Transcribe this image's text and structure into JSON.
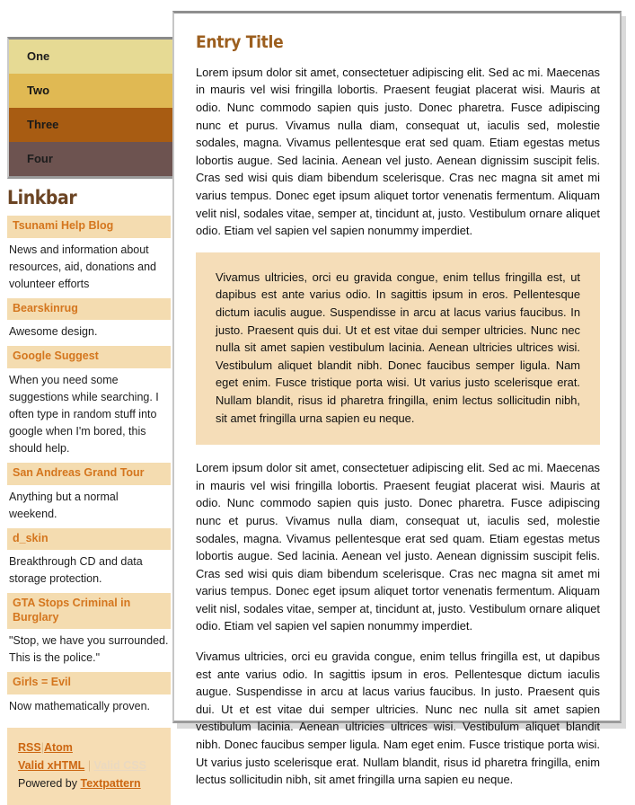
{
  "nav": {
    "items": [
      {
        "label": "One",
        "color": "#e6da94"
      },
      {
        "label": "Two",
        "color": "#e0b953"
      },
      {
        "label": "Three",
        "color": "#a85c12"
      },
      {
        "label": "Four",
        "color": "#6d5350"
      }
    ]
  },
  "linkbar": {
    "title": "Linkbar",
    "links": [
      {
        "title": "Tsunami Help Blog",
        "desc": "News and information about resources, aid, donations and volunteer efforts"
      },
      {
        "title": "Bearskinrug",
        "desc": "Awesome design."
      },
      {
        "title": "Google Suggest",
        "desc": "When you need some suggestions while searching. I often type in random stuff into google when I'm bored, this should help."
      },
      {
        "title": "San Andreas Grand Tour",
        "desc": "Anything but a normal weekend."
      },
      {
        "title": "d_skin",
        "desc": "Breakthrough CD and data storage protection."
      },
      {
        "title": "GTA Stops Criminal in Burglary",
        "desc": "\"Stop, we have you surrounded. This is the police.\""
      },
      {
        "title": "Girls = Evil",
        "desc": "Now mathematically proven."
      }
    ]
  },
  "footer": {
    "rss": "RSS",
    "atom": "Atom",
    "valid_xhtml": "Valid xHTML",
    "valid_css": "Valid CSS",
    "powered_by": "Powered by",
    "textpattern": "Textpattern",
    "separator": "|"
  },
  "entry": {
    "title": "Entry Title",
    "paragraph_1": "Lorem ipsum dolor sit amet, consectetuer adipiscing elit. Sed ac mi. Maecenas in mauris vel wisi fringilla lobortis. Praesent feugiat placerat wisi. Mauris at odio. Nunc commodo sapien quis justo. Donec pharetra. Fusce adipiscing nunc et purus. Vivamus nulla diam, consequat ut, iaculis sed, molestie sodales, magna. Vivamus pellentesque erat sed quam. Etiam egestas metus lobortis augue. Sed lacinia. Aenean vel justo. Aenean dignissim suscipit felis. Cras sed wisi quis diam bibendum scelerisque. Cras nec magna sit amet mi varius tempus. Donec eget ipsum aliquet tortor venenatis fermentum. Aliquam velit nisl, sodales vitae, semper at, tincidunt at, justo. Vestibulum ornare aliquet odio. Etiam vel sapien vel sapien nonummy imperdiet.",
    "blockquote": "Vivamus ultricies, orci eu gravida congue, enim tellus fringilla est, ut dapibus est ante varius odio. In sagittis ipsum in eros. Pellentesque dictum iaculis augue. Suspendisse in arcu at lacus varius faucibus. In justo. Praesent quis dui. Ut et est vitae dui semper ultricies. Nunc nec nulla sit amet sapien vestibulum lacinia. Aenean ultricies ultrices wisi. Vestibulum aliquet blandit nibh. Donec faucibus semper ligula. Nam eget enim. Fusce tristique porta wisi. Ut varius justo scelerisque erat. Nullam blandit, risus id pharetra fringilla, enim lectus sollicitudin nibh, sit amet fringilla urna sapien eu neque.",
    "paragraph_2": "Lorem ipsum dolor sit amet, consectetuer adipiscing elit. Sed ac mi. Maecenas in mauris vel wisi fringilla lobortis. Praesent feugiat placerat wisi. Mauris at odio. Nunc commodo sapien quis justo. Donec pharetra. Fusce adipiscing nunc et purus. Vivamus nulla diam, consequat ut, iaculis sed, molestie sodales, magna. Vivamus pellentesque erat sed quam. Etiam egestas metus lobortis augue. Sed lacinia. Aenean vel justo. Aenean dignissim suscipit felis. Cras sed wisi quis diam bibendum scelerisque. Cras nec magna sit amet mi varius tempus. Donec eget ipsum aliquet tortor venenatis fermentum. Aliquam velit nisl, sodales vitae, semper at, tincidunt at, justo. Vestibulum ornare aliquet odio. Etiam vel sapien vel sapien nonummy imperdiet.",
    "paragraph_3": "Vivamus ultricies, orci eu gravida congue, enim tellus fringilla est, ut dapibus est ante varius odio. In sagittis ipsum in eros. Pellentesque dictum iaculis augue. Suspendisse in arcu at lacus varius faucibus. In justo. Praesent quis dui. Ut et est vitae dui semper ultricies. Nunc nec nulla sit amet sapien vestibulum lacinia. Aenean ultricies ultrices wisi. Vestibulum aliquet blandit nibh. Donec faucibus semper ligula. Nam eget enim. Fusce tristique porta wisi. Ut varius justo scelerisque erat. Nullam blandit, risus id pharetra fringilla, enim lectus sollicitudin nibh, sit amet fringilla urna sapien eu neque."
  },
  "colors": {
    "nav_1": "#e6da94",
    "nav_2": "#e0b953",
    "nav_3": "#a85c12",
    "nav_4": "#6d5350",
    "link_head_bg": "#f4dcb0",
    "link_head_text": "#d4761e",
    "blockquote_bg": "#f5ddb8",
    "title_text": "#9c5f1f",
    "linkbar_title_text": "#6b4423",
    "footer_bg": "#f6ddb4",
    "footer_link": "#cc6611"
  }
}
